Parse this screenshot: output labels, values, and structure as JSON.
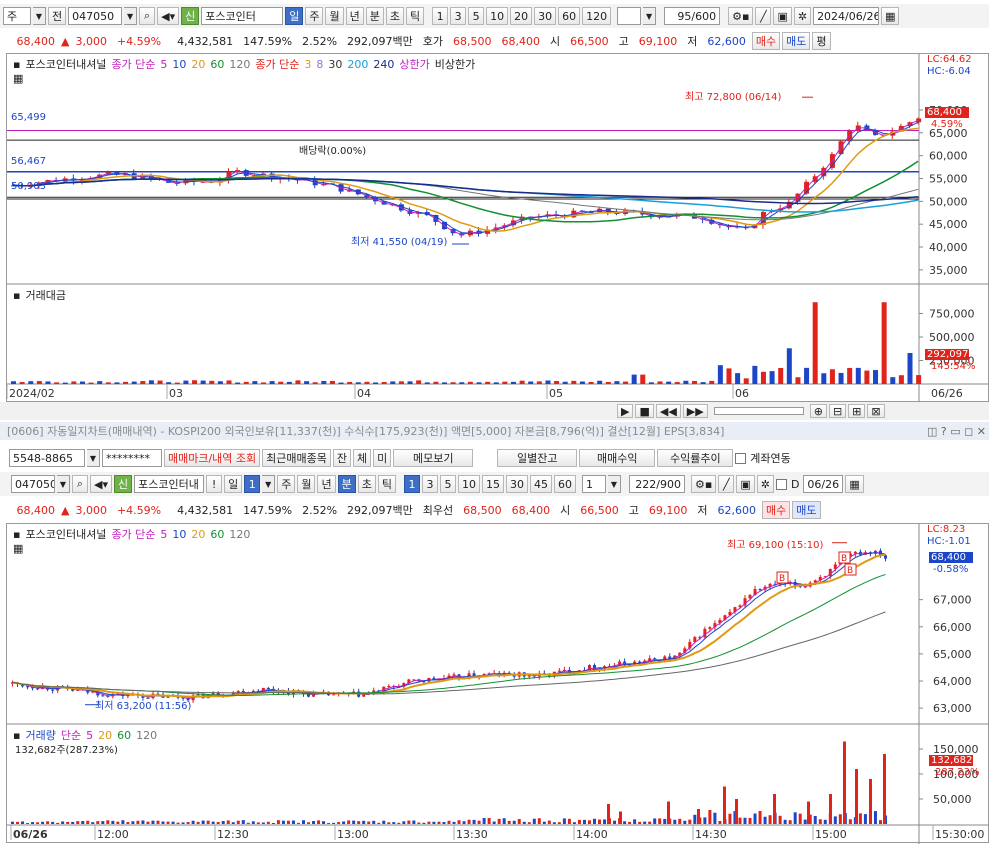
{
  "top_toolbar": {
    "type_select": "주",
    "prev_label": "전",
    "code": "047050",
    "sin_label": "신",
    "stock_name": "포스코인터",
    "periods": [
      "일",
      "주",
      "월",
      "년",
      "분",
      "초",
      "틱"
    ],
    "active_period": "일",
    "intervals": [
      "1",
      "3",
      "5",
      "10",
      "20",
      "30",
      "60",
      "120"
    ],
    "count": "95",
    "count_total": "/600",
    "date": "2024/06/26"
  },
  "quote_bar_top": {
    "price": "68,400",
    "arrow": "▲",
    "change": "3,000",
    "change_pct": "+4.59%",
    "volume": "4,432,581",
    "vol_ratio": "147.59%",
    "turnover": "2.52%",
    "amount": "292,097백만",
    "bid_label": "호가",
    "bid": "68,500",
    "ask": "68,400",
    "open_label": "시",
    "open": "66,500",
    "high_label": "고",
    "high": "69,100",
    "low_label": "저",
    "low": "62,600",
    "buy_label": "매수",
    "sell_label": "매도",
    "flat_label": "평"
  },
  "top_chart": {
    "legend": {
      "name": "포스코인터내셔널",
      "ma_title": "종가 단순",
      "ma": [
        "5",
        "10",
        "20",
        "60",
        "120"
      ],
      "ma2_title": "종가 단순",
      "ma2": [
        "3",
        "8",
        "30",
        "200",
        "240"
      ],
      "upper": "상한가",
      "lower": "비상한가"
    },
    "lc": "LC:64.62",
    "hc": "HC:-6.04",
    "price_tag": "68,400",
    "pct_tag": "4.59%",
    "left_tags": [
      "65,499",
      "56,467",
      "50,903"
    ],
    "high_note": "최고 72,800 (06/14)",
    "low_note": "최저 41,550 (04/19)",
    "div_note": "배당락(0.00%)",
    "y_ticks": [
      "70,000",
      "65,000",
      "60,000",
      "55,000",
      "50,000",
      "45,000",
      "40,000",
      "35,000"
    ],
    "volume_title": "거래대금",
    "vol_ticks": [
      "750,000",
      "500,000",
      "250,000"
    ],
    "vol_tag": "292,097",
    "vol_pct_tag": "145.54%",
    "x_labels": [
      "2024/02",
      "03",
      "04",
      "05",
      "06"
    ],
    "x_end": "06/26"
  },
  "info_strip": {
    "text": "[0606] 자동일지차트(매매내역) - KOSPI200 외국인보유[11,337(천)] 수식수[175,923(천)] 액면[5,000] 자본금[8,796(억)] 결산[12월] EPS[3,834]"
  },
  "account_bar": {
    "account": "5548-8865",
    "password": "********",
    "mark_btn": "매매마크/내역 조회",
    "recent_btn": "최근매매종목",
    "jan": "잔",
    "che": "체",
    "mi": "미",
    "memo": "메모보기",
    "daily": "일별잔고",
    "profit": "매매수익",
    "return": "수익률추이",
    "link": "계좌연동"
  },
  "bottom_toolbar": {
    "code": "047050",
    "sin_label": "신",
    "stock_name": "포스코인터내",
    "excl": "!",
    "day": "일",
    "day_n": "1",
    "periods": [
      "주",
      "월",
      "년",
      "분",
      "초",
      "틱"
    ],
    "active_period": "분",
    "intervals": [
      "1",
      "3",
      "5",
      "10",
      "15",
      "30",
      "45",
      "60"
    ],
    "active_interval": "1",
    "sel_n": "1",
    "count": "222",
    "count_total": "/900",
    "d_label": "D",
    "date": "06/26"
  },
  "quote_bar_bottom": {
    "price": "68,400",
    "arrow": "▲",
    "change": "3,000",
    "change_pct": "+4.59%",
    "volume": "4,432,581",
    "vol_ratio": "147.59%",
    "turnover": "2.52%",
    "amount": "292,097백만",
    "bid_label": "최우선",
    "bid": "68,500",
    "ask": "68,400",
    "open_label": "시",
    "open": "66,500",
    "high_label": "고",
    "high": "69,100",
    "low_label": "저",
    "low": "62,600",
    "buy_label": "매수",
    "sell_label": "매도"
  },
  "bottom_chart": {
    "legend": {
      "name": "포스코인터내셔널",
      "ma_title": "종가 단순",
      "ma": [
        "5",
        "10",
        "20",
        "60",
        "120"
      ]
    },
    "lc": "LC:8.23",
    "hc": "HC:-1.01",
    "price_tag": "68,400",
    "pct_tag": "-0.58%",
    "high_note": "최고 69,100 (15:10)",
    "low_note": "최저 63,200 (11:56)",
    "y_ticks": [
      "67,000",
      "66,000",
      "65,000",
      "64,000",
      "63,000"
    ],
    "volume_title": "거래량",
    "volume_ma_title": "단순",
    "volume_ma": [
      "5",
      "20",
      "60",
      "120"
    ],
    "volume_note": "132,682주(287.23%)",
    "vol_ticks": [
      "150,000",
      "100,000",
      "50,000"
    ],
    "vol_tag": "132,682",
    "vol_pct_tag": "287.23%",
    "x_labels": [
      "06/26",
      "12:00",
      "12:30",
      "13:00",
      "13:30",
      "14:00",
      "14:30",
      "15:00",
      "15:30:00"
    ],
    "b_mark": "B"
  },
  "colors": {
    "up": "#e0231b",
    "down": "#1b46c9",
    "accent": "#3d6fc6"
  }
}
